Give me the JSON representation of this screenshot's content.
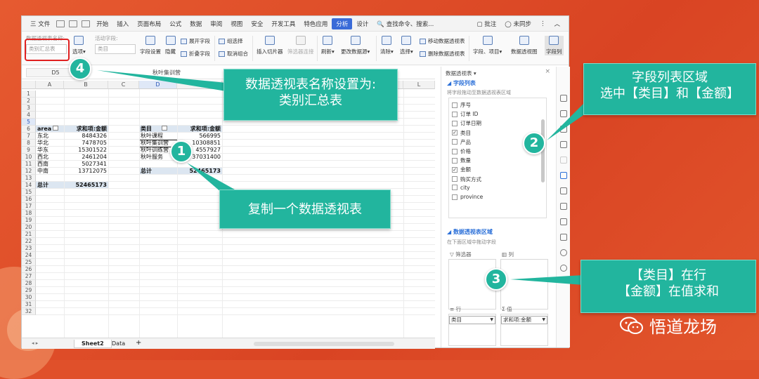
{
  "menu": {
    "file": "三 文件",
    "tabs": [
      "开始",
      "插入",
      "页面布局",
      "公式",
      "数据",
      "审阅",
      "视图",
      "安全",
      "开发工具",
      "特色应用",
      "分析",
      "设计"
    ],
    "active_tab": "分析",
    "search": "查找命令、搜索...",
    "comment": "批注",
    "sync": "未同步"
  },
  "ribbon": {
    "name_label": "数据透视表名称:",
    "name_value": "类别汇总表",
    "options": "选项",
    "active_field_label": "活动字段:",
    "active_field_value": "类目",
    "field_settings": "字段设置",
    "hide": "隐藏",
    "expand": "展开字段",
    "collapse": "折叠字段",
    "group_select": "组选择",
    "ungroup": "取消组合",
    "insert_slicer": "插入切片器",
    "filter_connect": "筛选器连接",
    "refresh": "刷新",
    "change_source": "更改数据源",
    "clear": "清除",
    "select": "选择",
    "move_pivot": "移动数据透视表",
    "delete_pivot": "删除数据透视表",
    "field_items": "字段、项目",
    "pivot_chart": "数据透视图",
    "field_list": "字段列"
  },
  "formula": {
    "cell_ref": "D5",
    "value": "秋叶集训营"
  },
  "grid": {
    "columns": [
      "A",
      "B",
      "C",
      "D",
      "E",
      "L"
    ],
    "rows": [
      "1",
      "2",
      "3",
      "4",
      "5",
      "6",
      "7",
      "8",
      "9",
      "10",
      "11",
      "12",
      "13",
      "14",
      "15",
      "16",
      "17",
      "18",
      "19",
      "20",
      "21",
      "22",
      "23",
      "24",
      "25",
      "26",
      "27",
      "28",
      "29",
      "30",
      "31",
      "32"
    ],
    "pivot1": {
      "header_left": "area",
      "header_right": "求和项:金额",
      "rows": [
        {
          "label": "东北",
          "value": "8484326"
        },
        {
          "label": "华北",
          "value": "7478705"
        },
        {
          "label": "华东",
          "value": "15301522"
        },
        {
          "label": "西北",
          "value": "2461204"
        },
        {
          "label": "西南",
          "value": "5027341"
        },
        {
          "label": "中南",
          "value": "13712075"
        }
      ],
      "total_label": "总计",
      "total_value": "52465173"
    },
    "pivot2": {
      "header_left": "类目",
      "header_right": "求和项:金额",
      "rows": [
        {
          "label": "秋叶课程",
          "value": "566995"
        },
        {
          "label": "秋叶集训营",
          "value": "10308851"
        },
        {
          "label": "秋叶训练营",
          "value": "4557927"
        },
        {
          "label": "秋叶服务",
          "value": "37031400"
        }
      ],
      "total_label": "总计",
      "total_value": "52465173"
    }
  },
  "sheets": {
    "tabs": [
      "Sheet2",
      "Data"
    ],
    "active": "Sheet2",
    "add": "+"
  },
  "pane": {
    "title": "数据透视表 ▾",
    "close": "×",
    "field_list_title": "字段列表",
    "field_list_hint": "将字段拖动至数据透视表区域",
    "fields": [
      {
        "name": "序号",
        "checked": false
      },
      {
        "name": "订单 ID",
        "checked": false
      },
      {
        "name": "订单日期",
        "checked": false
      },
      {
        "name": "类目",
        "checked": true
      },
      {
        "name": "产品",
        "checked": false
      },
      {
        "name": "价格",
        "checked": false
      },
      {
        "name": "数量",
        "checked": false
      },
      {
        "name": "金额",
        "checked": true
      },
      {
        "name": "购买方式",
        "checked": false
      },
      {
        "name": "city",
        "checked": false
      },
      {
        "name": "province",
        "checked": false
      }
    ],
    "areas_title": "数据透视表区域",
    "areas_hint": "在下面区域中拖动字段",
    "filter_label": "筛选器",
    "column_label": "列",
    "row_label": "行",
    "value_label": "值",
    "row_value": "类目",
    "value_value": "求和项:金额"
  },
  "callouts": {
    "c1": "数据透视表名称设置为:\n类别汇总表",
    "c2": "复制一个数据透视表",
    "c3": "字段列表区域\n选中【类目】和【金额】",
    "c4": "【类目】在行\n【金额】在值求和"
  },
  "badges": [
    "1",
    "2",
    "3",
    "4"
  ],
  "brand": "悟道龙场",
  "colors": {
    "teal": "#22b59e",
    "background": "#e0502a",
    "highlight_red": "#e02020"
  }
}
